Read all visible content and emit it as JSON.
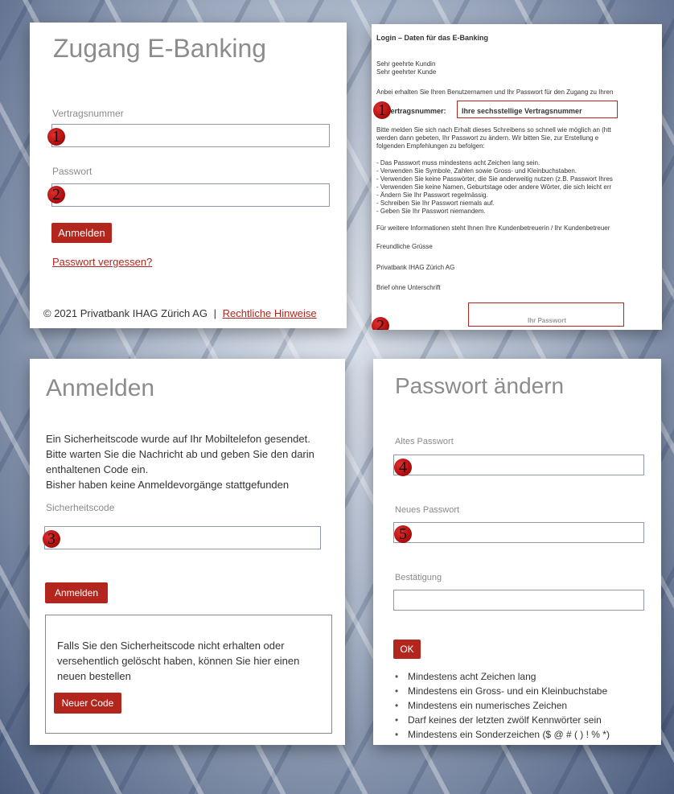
{
  "colors": {
    "accent": "#b3261e",
    "label": "#8a8a8a"
  },
  "login": {
    "title": "Zugang E-Banking",
    "contract_label": "Vertragsnummer",
    "password_label": "Passwort",
    "submit_label": "Anmelden",
    "forgot_link": "Passwort vergessen?",
    "footer_copyright": "© 2021 Privatbank IHAG Zürich AG",
    "footer_separator": "|",
    "footer_link": "Rechtliche Hinweise",
    "marker_1": "1",
    "marker_2": "2"
  },
  "letter": {
    "heading": "Login – Daten für das E-Banking",
    "salutation_1": "Sehr geehrte Kundin",
    "salutation_2": "Sehr geehrter Kunde",
    "intro": "Anbei erhalten Sie Ihren Benutzernamen und Ihr Passwort für den Zugang zu Ihren",
    "contract_label": "Vertragsnummer:",
    "contract_value": "Ihre sechsstellige Vertragsnummer",
    "para_1": "Bitte melden Sie sich nach Erhalt dieses Schreibens so schnell wie möglich an (htt",
    "para_2": "werden dann gebeten, Ihr Passwort zu ändern. Wir bitten Sie, zur Erstellung e",
    "para_3": "folgenden Empfehlungen zu befolgen:",
    "rules": [
      "- Das Passwort muss mindestens acht Zeichen lang sein.",
      "- Verwenden Sie Symbole, Zahlen sowie Gross- und Kleinbuchstaben.",
      "- Verwenden Sie keine Passwörter, die Sie anderweitig nutzen (z.B. Passwort Ihres",
      "- Verwenden Sie keine Namen, Geburtstage oder andere Wörter, die sich leicht err",
      "- Ändern Sie Ihr Passwort regelmässig.",
      "- Schreiben Sie Ihr Passwort niemals auf.",
      "- Geben Sie Ihr Passwort niemandem."
    ],
    "info": "Für weitere Informationen steht Ihnen Ihre Kundenbetreuerin / Ihr Kundenbetreuer",
    "greeting": "Freundliche Grüsse",
    "bank": "Privatbank IHAG Zürich AG",
    "signature": "Brief ohne Unterschrift",
    "password_box": "Ihr Passwort",
    "marker_1": "1",
    "marker_2": "2"
  },
  "otp": {
    "title": "Anmelden",
    "message_1": "Ein Sicherheitscode wurde auf Ihr Mobiltelefon gesendet.",
    "message_2": "Bitte warten Sie die Nachricht ab und geben Sie den darin",
    "message_3": "enthaltenen Code ein.",
    "message_4": "Bisher haben keine Anmeldevorgänge stattgefunden",
    "code_label": "Sicherheitscode",
    "submit_label": "Anmelden",
    "resend_text_1": "Falls Sie den Sicherheitscode nicht erhalten oder",
    "resend_text_2": "versehentlich gelöscht haben, können Sie hier einen",
    "resend_text_3": "neuen bestellen",
    "new_code_label": "Neuer Code",
    "marker_3": "3"
  },
  "change_pw": {
    "title": "Passwort ändern",
    "old_label": "Altes Passwort",
    "new_label": "Neues Passwort",
    "confirm_label": "Bestätigung",
    "ok_label": "OK",
    "rules": [
      "Mindestens acht Zeichen lang",
      "Mindestens ein Gross- und ein Kleinbuchstabe",
      "Mindestens ein numerisches Zeichen",
      "Darf keines der letzten zwölf Kennwörter sein",
      "Mindestens ein Sonderzeichen ($ @ # ( ) ! % *)"
    ],
    "bullet": "•",
    "marker_4": "4",
    "marker_5": "5"
  }
}
